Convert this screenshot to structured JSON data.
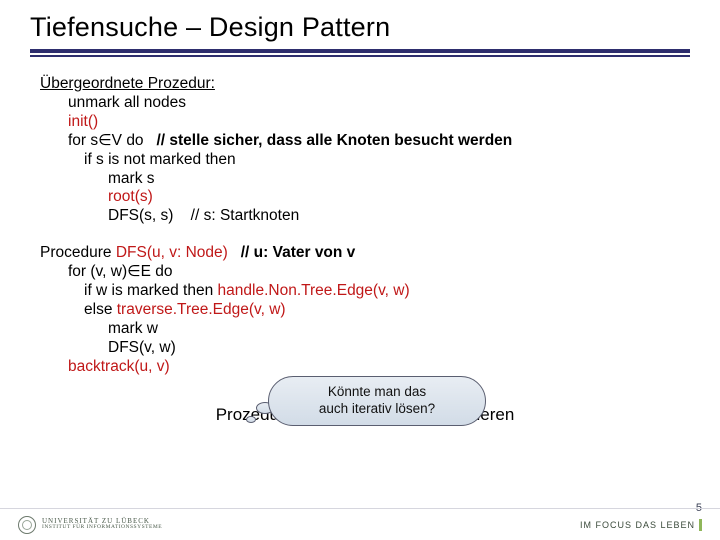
{
  "title": "Tiefensuche – Design Pattern",
  "proc1": {
    "heading": "Übergeordnete Prozedur:",
    "l_unmark": "unmark all nodes",
    "l_init": "init()",
    "l_for_pre": "for s",
    "l_for_in": "∈",
    "l_for_set": "V do",
    "l_for_comment": "// stelle sicher, dass alle Knoten besucht werden",
    "l_if": "if s is not marked then",
    "l_mark": "mark s",
    "l_root": "root(s)",
    "l_dfs": "DFS(s, s)",
    "l_dfs_comment": "// s: Startknoten"
  },
  "proc2": {
    "l_proc_pre": "Procedure ",
    "l_proc_name": "DFS",
    "l_proc_sig": "(u, v: Node)",
    "l_proc_comment": "// u: Vater von v",
    "l_for": "for (v, w)∈E do",
    "l_if": "if w is marked then ",
    "l_handle": "handle.Non.Tree.Edge(v, w)",
    "l_else": "else ",
    "l_traverse": "traverse.Tree.Edge(v, w)",
    "l_mark": "mark w",
    "l_dfs": "DFS(v, w)",
    "l_backtrack": "backtrack(u, v)"
  },
  "bubble": {
    "line1": "Könnte man das",
    "line2": "auch iterativ lösen?"
  },
  "footer_note": "Prozeduren in rot: noch zu spezifizieren",
  "footer": {
    "uni1": "UNIVERSITÄT ZU LÜBECK",
    "uni2": "INSTITUT FÜR INFORMATIONSSYSTEME",
    "focus": "IM FOCUS DAS LEBEN",
    "page": "5"
  }
}
